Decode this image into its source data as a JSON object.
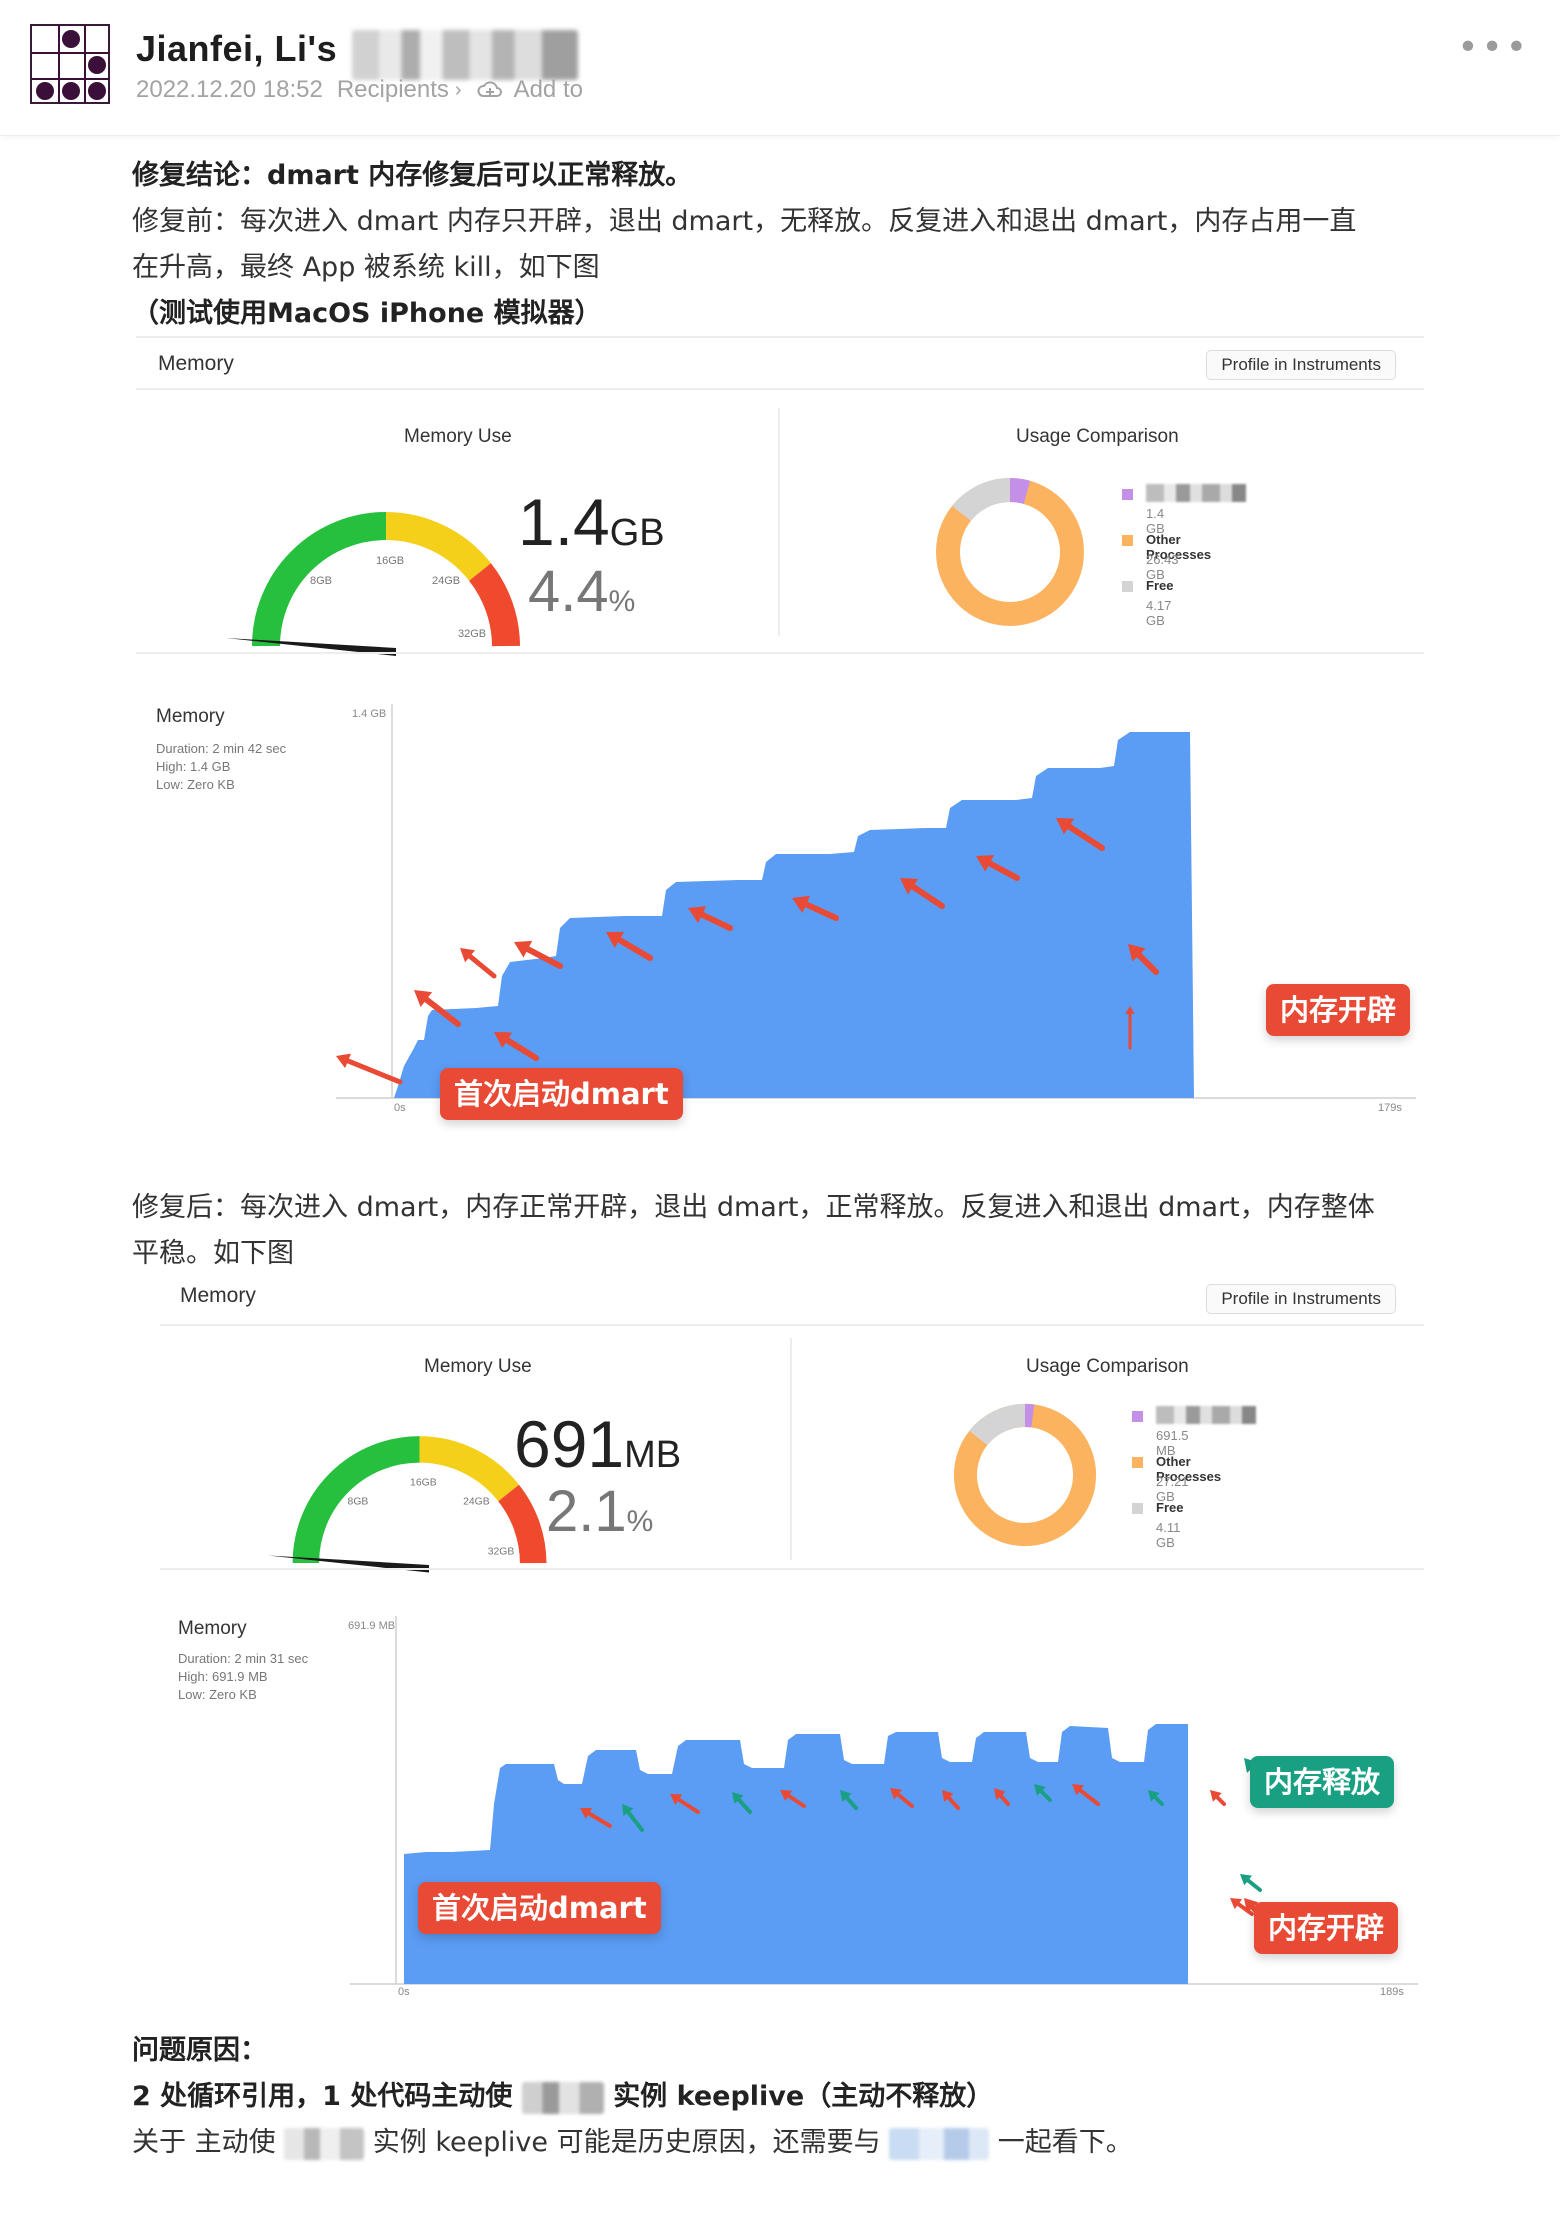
{
  "header": {
    "author": "Jianfei, Li's",
    "timestamp": "2022.12.20 18:52",
    "recipients_label": "Recipients",
    "add_to_label": "Add to"
  },
  "post": {
    "conclusion": "修复结论：dmart 内存修复后可以正常释放。",
    "before_line1": "修复前：每次进入 dmart 内存只开辟，退出 dmart，无释放。反复进入和退出 dmart，内存占用一直",
    "before_line2": "在升高，最终 App 被系统 kill，如下图",
    "test_note": "（测试使用MacOS iPhone 模拟器）",
    "after_line1": "修复后：每次进入 dmart，内存正常开辟，退出 dmart，正常释放。反复进入和退出 dmart，内存整体",
    "after_line2": "平稳。如下图",
    "cause_title": "问题原因：",
    "cause_line_a": "2 处循环引用，1 处代码主动使",
    "cause_line_b": "实例 keeplive（主动不释放）",
    "about_a": "关于 主动使",
    "about_b": "实例 keeplive 可能是历史原因，还需要与",
    "about_c": "一起看下。"
  },
  "panel_before": {
    "title": "Memory",
    "profile_button": "Profile in Instruments",
    "memory_use_label": "Memory Use",
    "usage_label": "Usage Comparison",
    "gauge_ticks": [
      "8GB",
      "16GB",
      "24GB",
      "32GB"
    ],
    "value": "1.4",
    "value_unit": "GB",
    "percent": "4.4",
    "percent_unit": "%",
    "usage_percent": 4.4,
    "legend": [
      {
        "name": "",
        "value": "1.4 GB",
        "color": "#c48fe6"
      },
      {
        "name": "Other Processes",
        "value": "26.43 GB",
        "color": "#fbb35f"
      },
      {
        "name": "Free",
        "value": "4.17 GB",
        "color": "#d4d4d4"
      }
    ],
    "graph_title": "Memory",
    "duration": "Duration: 2 min 42 sec",
    "high": "High: 1.4 GB",
    "low": "Low: Zero KB",
    "y_max_label": "1.4 GB",
    "x_start": "0s",
    "x_end": "179s",
    "callout_first": "首次启动dmart",
    "callout_alloc": "内存开辟"
  },
  "panel_after": {
    "title": "Memory",
    "profile_button": "Profile in Instruments",
    "memory_use_label": "Memory Use",
    "usage_label": "Usage Comparison",
    "gauge_ticks": [
      "8GB",
      "16GB",
      "24GB",
      "32GB"
    ],
    "value": "691",
    "value_unit": "MB",
    "percent": "2.1",
    "percent_unit": "%",
    "usage_percent": 2.1,
    "legend": [
      {
        "name": "",
        "value": "691.5 MB",
        "color": "#c48fe6"
      },
      {
        "name": "Other Processes",
        "value": "27.21 GB",
        "color": "#fbb35f"
      },
      {
        "name": "Free",
        "value": "4.11 GB",
        "color": "#d4d4d4"
      }
    ],
    "graph_title": "Memory",
    "duration": "Duration: 2 min 31 sec",
    "high": "High: 691.9 MB",
    "low": "Low: Zero KB",
    "y_max_label": "691.9 MB",
    "x_start": "0s",
    "x_end": "189s",
    "callout_first": "首次启动dmart",
    "callout_release": "内存释放",
    "callout_alloc": "内存开辟"
  },
  "colors": {
    "fill": "#5b9cf4",
    "gauge_green": "#27c03e",
    "gauge_yellow": "#f5d01a",
    "gauge_red": "#ef4a2d",
    "arrow_red": "#e84a35",
    "arrow_teal": "#19a083"
  }
}
